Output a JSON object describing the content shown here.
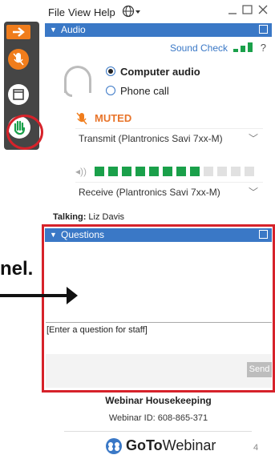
{
  "menu": {
    "file": "File",
    "view": "View",
    "help": "Help",
    "globe_icon": "globe-icon",
    "window_controls": [
      "minimize",
      "restore",
      "close"
    ]
  },
  "audio": {
    "header": "Audio",
    "sound_check": "Sound Check",
    "help_mark": "?",
    "options": [
      {
        "label": "Computer audio",
        "selected": true
      },
      {
        "label": "Phone call",
        "selected": false
      }
    ],
    "muted_label": "MUTED",
    "transmit_device": "Transmit (Plantronics Savi 7xx-M)",
    "receive_device": "Receive (Plantronics Savi 7xx-M)",
    "speaker_level": 0.67
  },
  "talking": {
    "label": "Talking:",
    "name": "Liz Davis"
  },
  "questions": {
    "header": "Questions",
    "placeholder": "[Enter a question for staff]",
    "send": "Send"
  },
  "callout": {
    "partial_text": "nel."
  },
  "footer": {
    "title": "Webinar Housekeeping",
    "webinar_id": "Webinar ID: 608-865-371",
    "brand_goto": "GoTo",
    "brand_webinar": "Webinar",
    "page_number": "4"
  },
  "colors": {
    "accent_blue": "#3a78c6",
    "orange": "#f07d1c",
    "highlight_red": "#d6222a",
    "meter_green": "#1aa04a"
  }
}
